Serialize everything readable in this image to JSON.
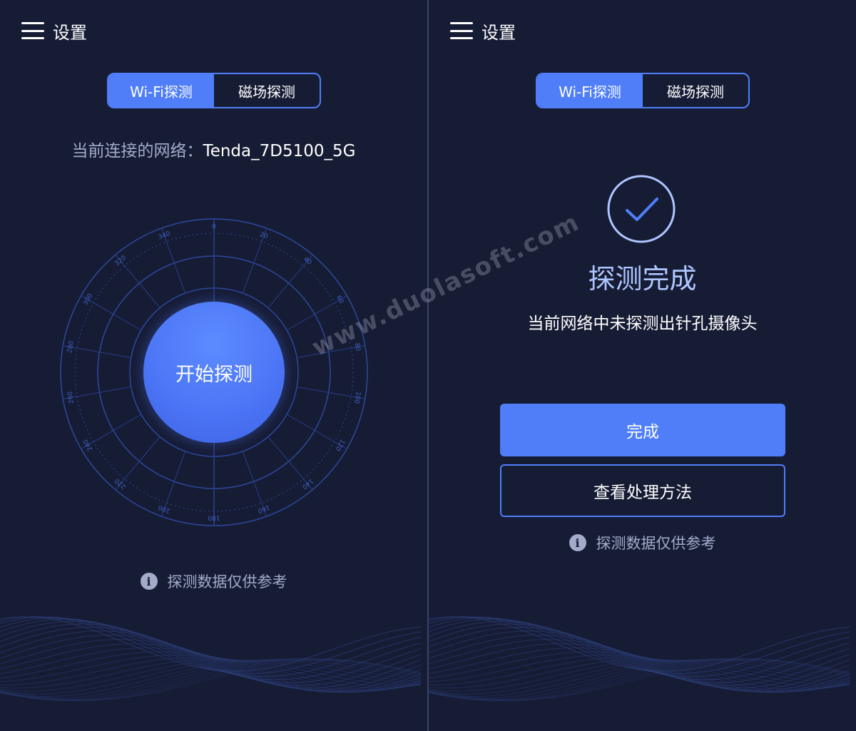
{
  "left_screen": {
    "menu_label": "设置",
    "tabs": [
      {
        "label": "Wi-Fi探测",
        "active": true
      },
      {
        "label": "磁场探测",
        "active": false
      }
    ],
    "network_label": "当前连接的网络：",
    "network_name": "Tenda_7D5100_5G",
    "start_button": "开始探测",
    "dial_ticks": [
      "0",
      "20",
      "40",
      "60",
      "80",
      "100",
      "120",
      "140",
      "160",
      "180",
      "200",
      "220",
      "240",
      "260",
      "280",
      "300",
      "320",
      "340"
    ],
    "note": "探测数据仅供参考",
    "info_icon": "i"
  },
  "right_screen": {
    "menu_label": "设置",
    "tabs": [
      {
        "label": "Wi-Fi探测",
        "active": true
      },
      {
        "label": "磁场探测",
        "active": false
      }
    ],
    "status_title": "探测完成",
    "status_desc": "当前网络中未探测出针孔摄像头",
    "done_button": "完成",
    "method_button": "查看处理方法",
    "note": "探测数据仅供参考",
    "info_icon": "i"
  },
  "watermark": "www.duolasoft.com",
  "colors": {
    "background": "#171c35",
    "accent": "#4f7ef8",
    "muted_text": "#a4abc8",
    "success_title": "#aec6ff"
  },
  "icons": [
    "menu-icon",
    "info-icon",
    "check-icon"
  ]
}
